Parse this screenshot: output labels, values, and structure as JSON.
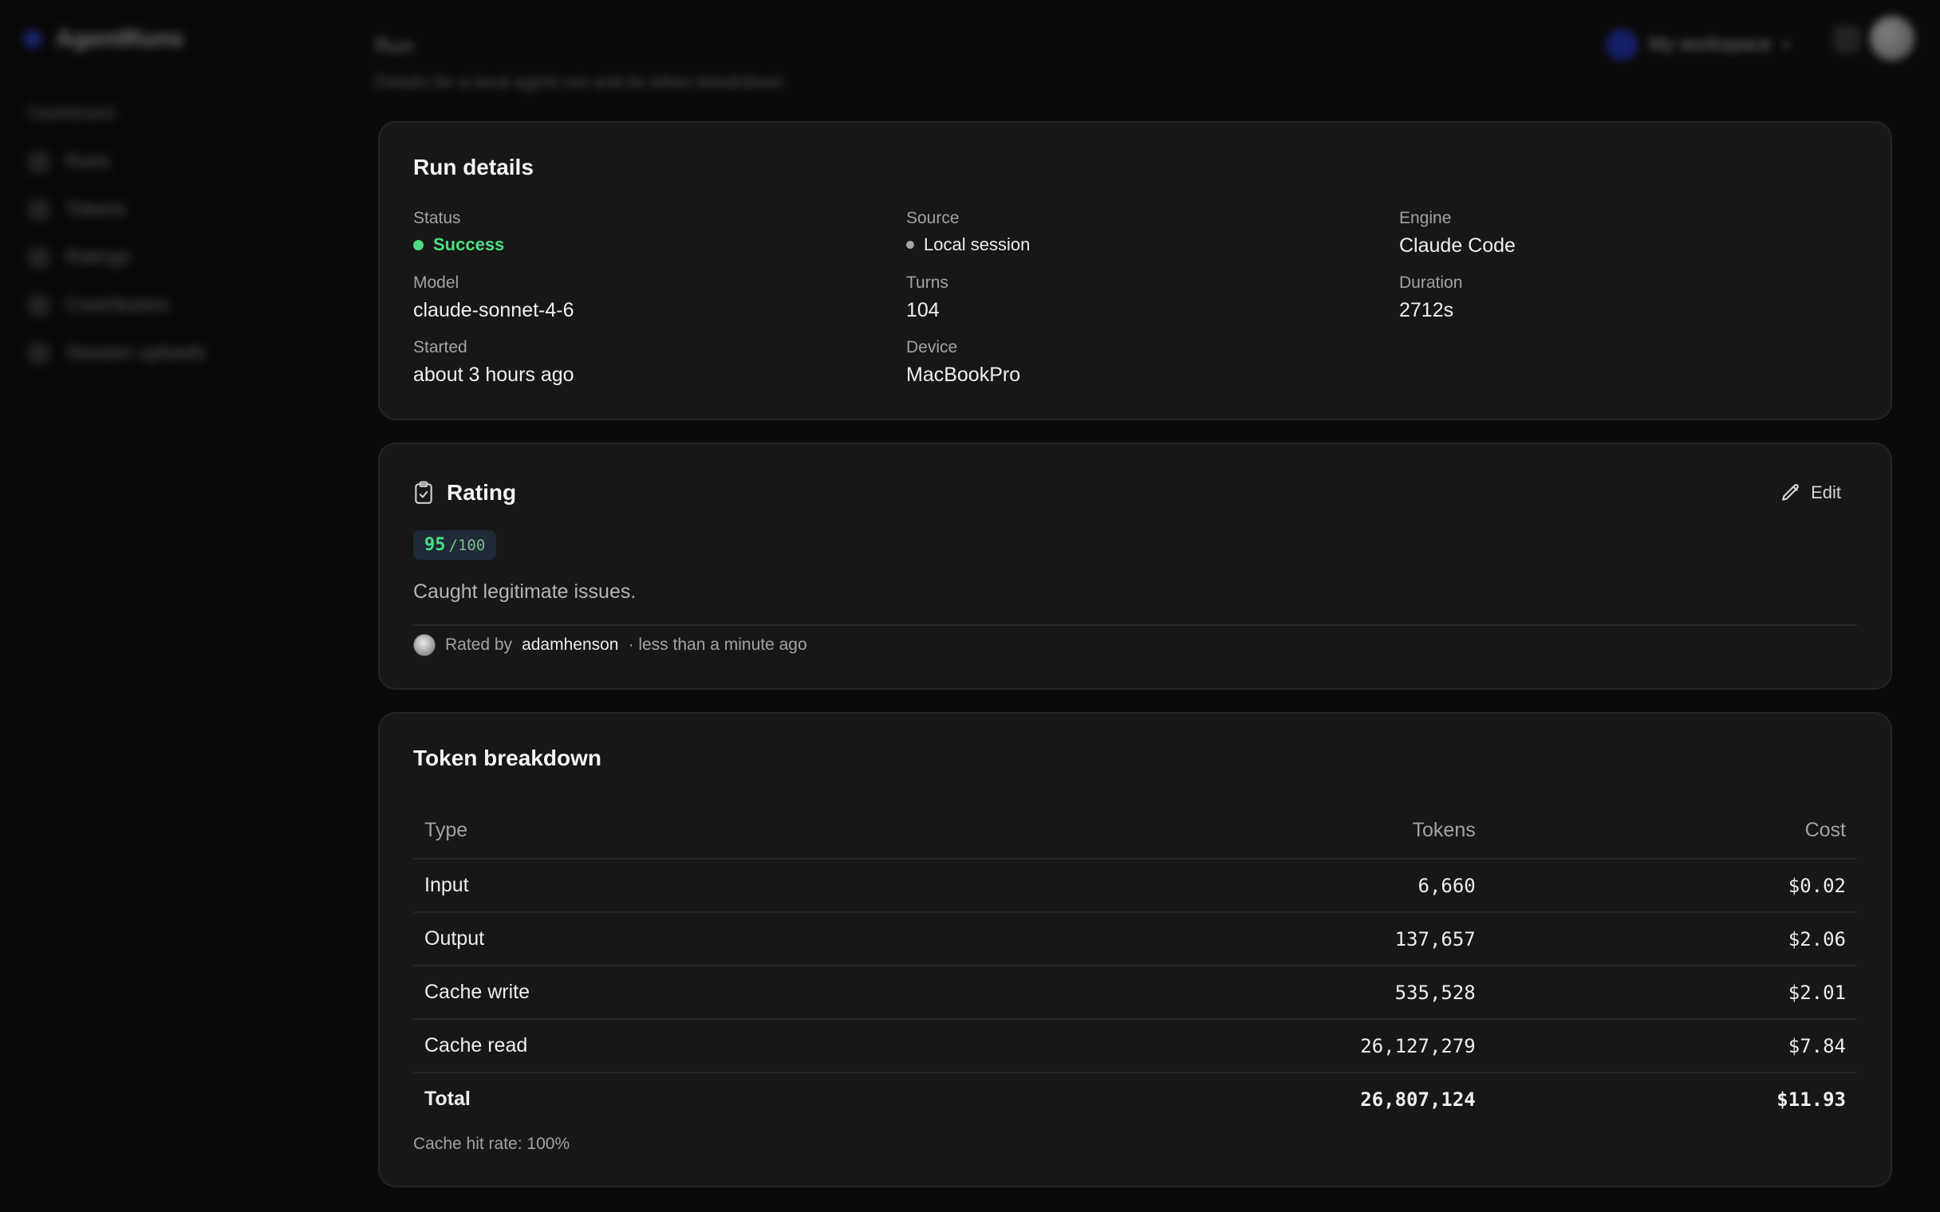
{
  "sidebar": {
    "brand_name": "AgentRuns",
    "section_heading": "Dashboard",
    "items": [
      {
        "label": "Runs"
      },
      {
        "label": "Tokens"
      },
      {
        "label": "Ratings"
      },
      {
        "label": "Contributors"
      },
      {
        "label": "Session uploads"
      }
    ]
  },
  "topbar": {
    "breadcrumb": "Run",
    "subtitle": "Details for a local agent run and its token breakdown",
    "org_name": "My workspace"
  },
  "run_details": {
    "title": "Run details",
    "status_label": "Status",
    "status_value": "Success",
    "source_label": "Source",
    "source_value": "Local session",
    "engine_label": "Engine",
    "engine_value": "Claude Code",
    "model_label": "Model",
    "model_value": "claude-sonnet-4-6",
    "turns_label": "Turns",
    "turns_value": "104",
    "duration_label": "Duration",
    "duration_value": "2712s",
    "started_label": "Started",
    "started_value": "about 3 hours ago",
    "device_label": "Device",
    "device_value": "MacBookPro"
  },
  "rating": {
    "title": "Rating",
    "edit_label": "Edit",
    "score": "95",
    "score_max": "/100",
    "comment": "Caught legitimate issues.",
    "rated_by_prefix": "Rated by",
    "rater": "adamhenson",
    "rated_time": "· less than a minute ago"
  },
  "tokens": {
    "title": "Token breakdown",
    "headers": {
      "type": "Type",
      "tokens": "Tokens",
      "cost": "Cost"
    },
    "rows": [
      {
        "type": "Input",
        "tokens": "6,660",
        "cost": "$0.02"
      },
      {
        "type": "Output",
        "tokens": "137,657",
        "cost": "$2.06"
      },
      {
        "type": "Cache write",
        "tokens": "535,528",
        "cost": "$2.01"
      },
      {
        "type": "Cache read",
        "tokens": "26,127,279",
        "cost": "$7.84"
      }
    ],
    "total": {
      "type": "Total",
      "tokens": "26,807,124",
      "cost": "$11.93"
    },
    "cache_hit_rate": "Cache hit rate: 100%"
  },
  "colors": {
    "success": "#4ade80",
    "background": "#0b0b0b",
    "card": "#171717"
  }
}
